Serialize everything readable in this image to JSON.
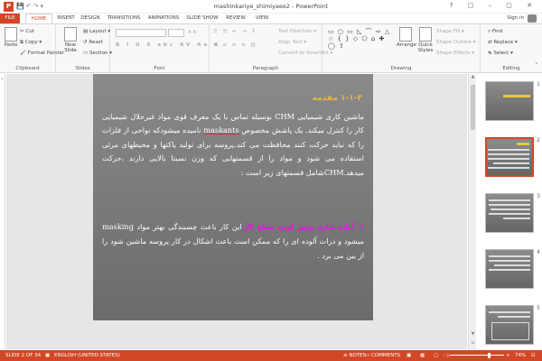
{
  "window": {
    "app_icon": "P",
    "title": "mashinkariye_shimiyaee2 - PowerPoint",
    "controls": "? ▢ – ▢ ✕"
  },
  "tabs": [
    "FILE",
    "HOME",
    "INSERT",
    "DESIGN",
    "TRANSITIONS",
    "ANIMATIONS",
    "SLIDE SHOW",
    "REVIEW",
    "VIEW"
  ],
  "account": {
    "signin": "Sign in"
  },
  "ribbon": {
    "clipboard": {
      "label": "Clipboard",
      "paste": "Paste",
      "cut": "Cut",
      "copy": "Copy",
      "format_painter": "Format Painter"
    },
    "slides": {
      "label": "Slides",
      "new_slide": "New Slide",
      "layout": "Layout",
      "reset": "Reset",
      "section": "Section"
    },
    "font": {
      "label": "Font",
      "font_name": "",
      "font_size": ""
    },
    "paragraph": {
      "label": "Paragraph",
      "text_direction": "Text Direction",
      "align_text": "Align Text",
      "convert_smartart": "Convert to SmartArt"
    },
    "drawing": {
      "label": "Drawing",
      "arrange": "Arrange",
      "quick_styles": "Quick Styles",
      "shape_fill": "Shape Fill",
      "shape_outline": "Shape Outline",
      "shape_effects": "Shape Effects"
    },
    "editing": {
      "label": "Editing",
      "find": "Find",
      "replace": "Replace",
      "select": "Select"
    }
  },
  "slide": {
    "title": "۱-۱-۳ مقدمه",
    "p1_a": "ماشین کاری شیمیایی ",
    "p1_chm": "CHM",
    "p1_b": " بوسیله تماس با یک معرف قوی مواد غیرحلال شیمیایی کار را کنترل میکند. یک پاشش مخصوص ",
    "p1_maskant": "maskants",
    "p1_c": " نامیده میشودکه نواحی از فلزات را که نباید حرکت کنند محافظت می کند.پروسه برای تولید پاکتها و محیطهای مرئی استفاده می شود و مواد را از قسمتهایی که وزن نسبتا بالایی دارند ،حرکت میدهد.",
    "p1_chm2": "CHM",
    "p1_d": "شامل قسمتهای زیر است :",
    "p2_head": "۱- آماده سازی وتمیز کردن سطح کار:",
    "p2_a": "این کار باعث چسبندگی بهتر مواد ",
    "p2_masking": "masking",
    "p2_b": " میشود و ذرات آلوده ای را که ممکن است باعث اشکال در کار پروسه ماشین شود را از بین می برد ."
  },
  "thumbnails": [
    {
      "num": "1",
      "selected": false
    },
    {
      "num": "2",
      "selected": true
    },
    {
      "num": "3",
      "selected": false
    },
    {
      "num": "4",
      "selected": false
    },
    {
      "num": "5",
      "selected": false
    }
  ],
  "status": {
    "slide_of": "SLIDE 2 OF 34",
    "language": "ENGLISH (UNITED STATES)",
    "notes": "NOTES",
    "comments": "COMMENTS",
    "zoom": "74%"
  },
  "colors": {
    "accent": "#d24726",
    "title_gold": "#e8b83a",
    "highlight": "#ff00ff"
  }
}
